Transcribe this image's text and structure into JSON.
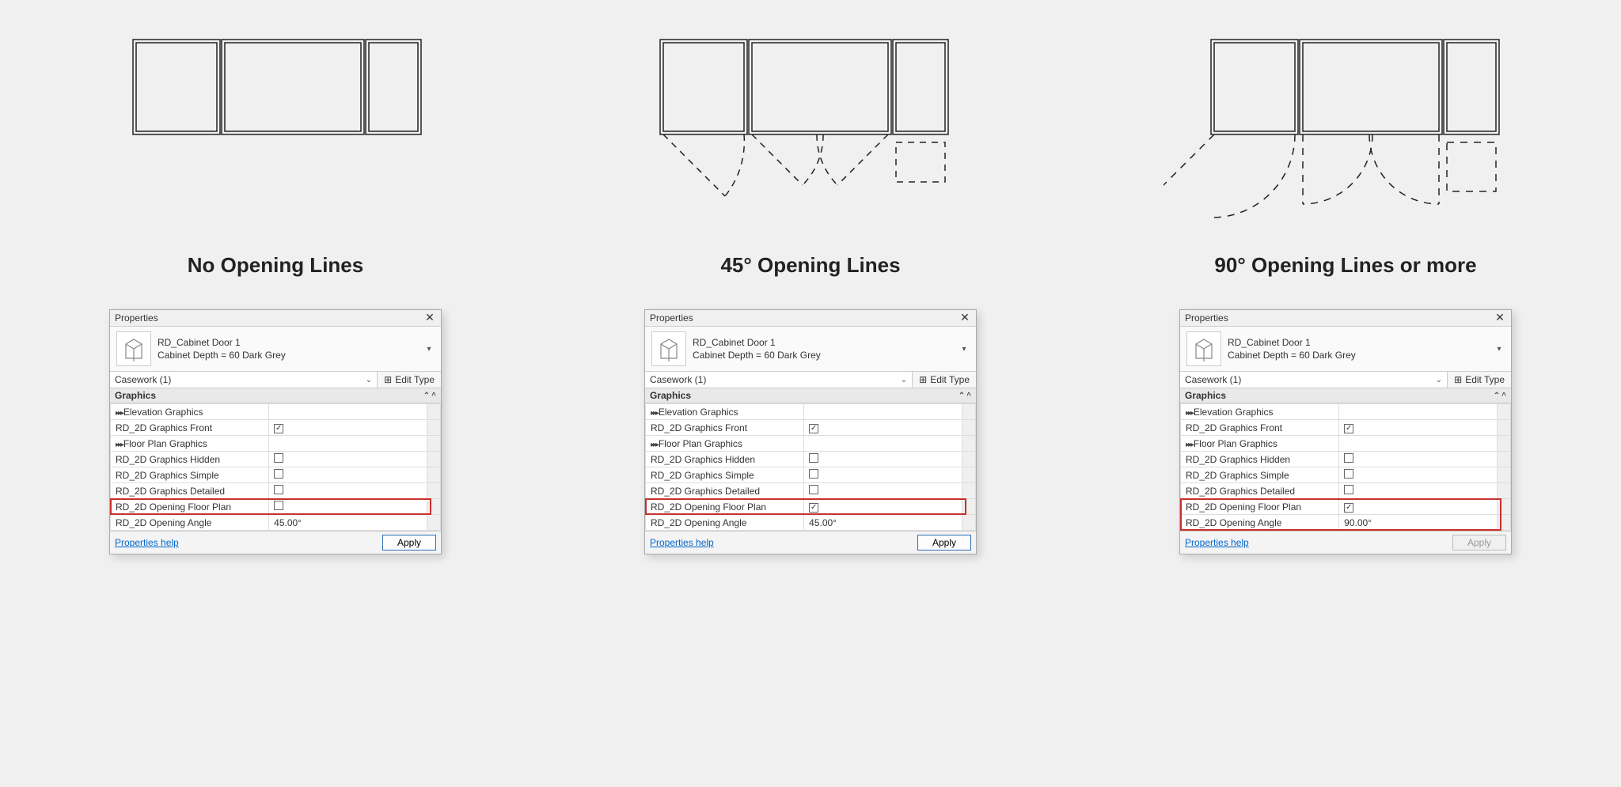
{
  "captions": {
    "c1": "No Opening Lines",
    "c2": "45° Opening Lines",
    "c3": "90° Opening Lines or more"
  },
  "panel": {
    "title": "Properties",
    "type_name": "RD_Cabinet Door 1",
    "type_variant": "Cabinet Depth = 60 Dark Grey",
    "category": "Casework (1)",
    "edit_type": "Edit Type",
    "group": "Graphics",
    "help_link": "Properties help",
    "apply": "Apply"
  },
  "params": {
    "elev": "Elevation Graphics",
    "front": "RD_2D Graphics Front",
    "floor": "Floor Plan Graphics",
    "hidden": "RD_2D Graphics Hidden",
    "simple": "RD_2D Graphics Simple",
    "detailed": "RD_2D Graphics Detailed",
    "opening_fp": "RD_2D Opening Floor Plan",
    "opening_angle": "RD_2D Opening Angle"
  },
  "variants": [
    {
      "opening_checked": false,
      "angle": "45.00°",
      "highlight_angle": false,
      "apply_enabled": true
    },
    {
      "opening_checked": true,
      "angle": "45.00°",
      "highlight_angle": false,
      "apply_enabled": true
    },
    {
      "opening_checked": true,
      "angle": "90.00°",
      "highlight_angle": true,
      "apply_enabled": false
    }
  ]
}
